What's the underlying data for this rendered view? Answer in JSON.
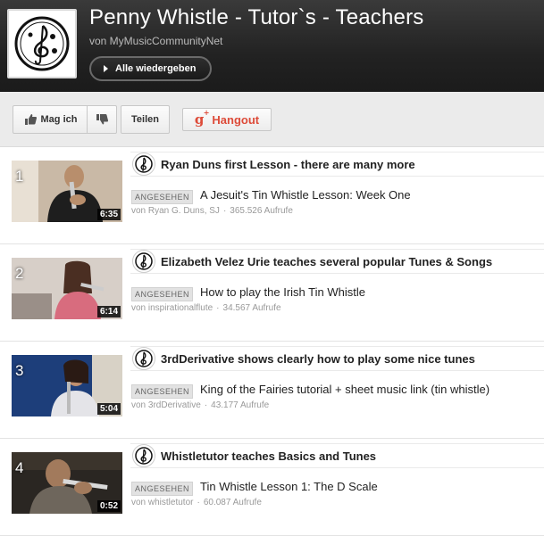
{
  "header": {
    "title": "Penny Whistle - Tutor`s - Teachers",
    "byline": "von MyMusicCommunityNet",
    "play_all_label": "Alle wiedergeben",
    "logo_icon": "treble-clef-logo"
  },
  "actions": {
    "like_label": "Mag ich",
    "dislike_icon": "thumbs-down-icon",
    "share_label": "Teilen",
    "hangout_label": "Hangout",
    "hangout_icon": "google-plus-icon"
  },
  "colors": {
    "header_bg": "#222222",
    "hangout_red": "#dd4b39",
    "action_bg": "#ebebeb"
  },
  "videos": [
    {
      "index": "1",
      "duration": "6:35",
      "note": "Ryan Duns first Lesson - there are many more",
      "watched_label": "ANGESEHEN",
      "title": "A Jesuit's Tin Whistle Lesson: Week One",
      "uploader": "von Ryan G. Duns, SJ",
      "views": "365.526 Aufrufe"
    },
    {
      "index": "2",
      "duration": "6:14",
      "note": "Elizabeth Velez Urie teaches several popular Tunes & Songs",
      "watched_label": "ANGESEHEN",
      "title": "How to play the Irish Tin Whistle",
      "uploader": "von inspirationalflute",
      "views": "34.567 Aufrufe"
    },
    {
      "index": "3",
      "duration": "5:04",
      "note": "3rdDerivative shows clearly how to play some nice tunes",
      "watched_label": "ANGESEHEN",
      "title": "King of the Fairies tutorial + sheet music link (tin whistle)",
      "uploader": "von 3rdDerivative",
      "views": "43.177 Aufrufe"
    },
    {
      "index": "4",
      "duration": "0:52",
      "note": "Whistletutor teaches Basics and Tunes",
      "watched_label": "ANGESEHEN",
      "title": "Tin Whistle Lesson 1: The D Scale",
      "uploader": "von whistletutor",
      "views": "60.087 Aufrufe"
    }
  ]
}
